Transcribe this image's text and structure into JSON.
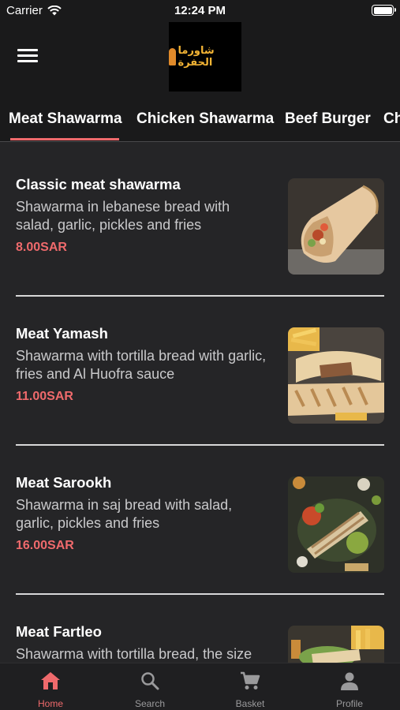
{
  "status_bar": {
    "carrier": "Carrier",
    "time": "12:24 PM"
  },
  "header": {
    "logo_text": "شاورما الحفرة"
  },
  "tabs": [
    {
      "label": "Meat Shawarma",
      "active": true
    },
    {
      "label": "Chicken Shawarma",
      "active": false
    },
    {
      "label": "Beef Burger",
      "active": false
    },
    {
      "label": "Ch",
      "active": false
    }
  ],
  "items": [
    {
      "name": "Classic meat shawarma",
      "description": "Shawarma in lebanese bread with salad, garlic, pickles and fries",
      "price": "8.00SAR"
    },
    {
      "name": "Meat Yamash",
      "description": "Shawarma with tortilla bread with garlic, fries and Al Huofra sauce",
      "price": "11.00SAR"
    },
    {
      "name": "Meat Sarookh",
      "description": "Shawarma in saj bread with salad, garlic, pickles and fries",
      "price": "16.00SAR"
    },
    {
      "name": "Meat Fartleo",
      "description": "Shawarma with tortilla bread, the size",
      "price": ""
    }
  ],
  "tabbar": [
    {
      "label": "Home",
      "icon": "home-icon",
      "active": true
    },
    {
      "label": "Search",
      "icon": "search-icon",
      "active": false
    },
    {
      "label": "Basket",
      "icon": "basket-icon",
      "active": false
    },
    {
      "label": "Profile",
      "icon": "profile-icon",
      "active": false
    }
  ],
  "colors": {
    "accent": "#ef6a6c",
    "background": "#252527",
    "bar": "#1a1a1b"
  }
}
